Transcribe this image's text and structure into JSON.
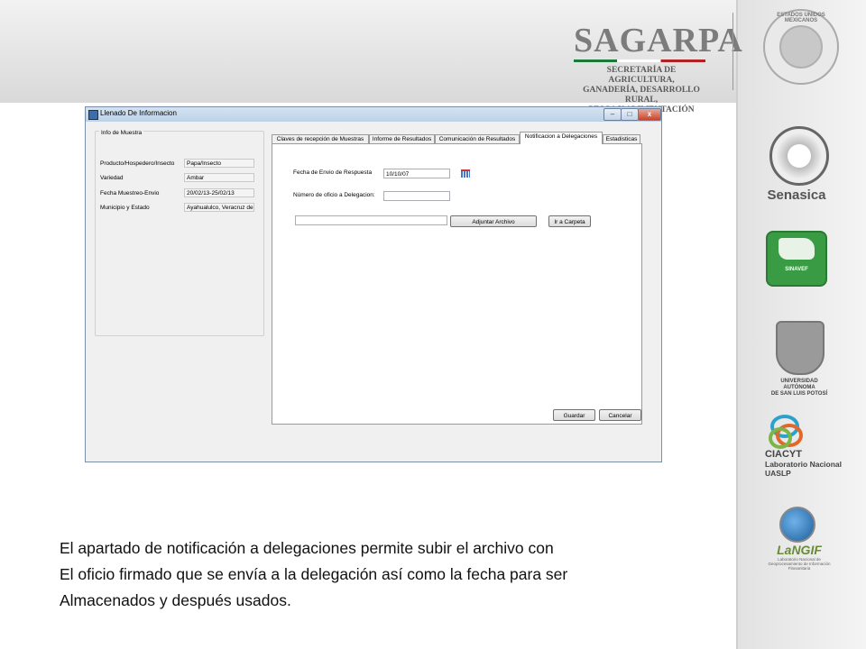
{
  "branding": {
    "sagarpa": "SAGARPA",
    "secretaria": [
      "SECRETARÍA DE AGRICULTURA,",
      "GANADERÍA, DESARROLLO RURAL,",
      "PESCA Y ALIMENTACIÓN"
    ],
    "seal_text": "ESTADOS UNIDOS MEXICANOS"
  },
  "sidebar_logos": {
    "senasica": "Senasica",
    "sinavef": "SINAVEF",
    "uaslp": [
      "UNIVERSIDAD AUTÓNOMA",
      "DE SAN LUIS POTOSÍ"
    ],
    "ciacyt_title": "CIACYT",
    "ciacyt_sub": [
      "Laboratorio Nacional",
      "UASLP"
    ],
    "langif": "LaNGIF",
    "langif_sub": "Laboratorio Nacional de Geoprocesamiento de Información Fitosanitaria"
  },
  "window": {
    "title": "Llenado De Informacion",
    "controls": [
      "–",
      "□",
      "x"
    ],
    "group": {
      "legend": "Info de Muestra",
      "fields": [
        {
          "label": "Producto/Hospedero/Insecto",
          "value": "Papa/Insecto"
        },
        {
          "label": "Variedad",
          "value": "Ambar"
        },
        {
          "label": "Fecha Muestreo-Envio",
          "value": "20/02/13-25/02/13"
        },
        {
          "label": "Municipio y Estado",
          "value": "Ayahualulco, Veracruz de"
        }
      ]
    },
    "tabs": [
      "Claves de recepción de Muestras",
      "Informe de Resultados",
      "Comunicación de Resultados",
      "Notificacion a Delegaciones",
      "Estadisticas"
    ],
    "active_tab": 3,
    "form": {
      "fecha_label": "Fecha de Envio de Respuesta",
      "fecha_value": "10/10/07",
      "oficio_label": "Número de oficio a Delegacion:",
      "oficio_value": "",
      "archivo_value": "",
      "adjuntar": "Adjuntar Archivo",
      "ir_carpeta": "Ir a Carpeta",
      "guardar": "Guardar",
      "cancelar": "Cancelar"
    }
  },
  "caption": [
    "El apartado de notificación a delegaciones permite subir el archivo con",
    "El oficio firmado que se envía a la delegación así como la fecha para ser",
    "Almacenados y después usados."
  ]
}
